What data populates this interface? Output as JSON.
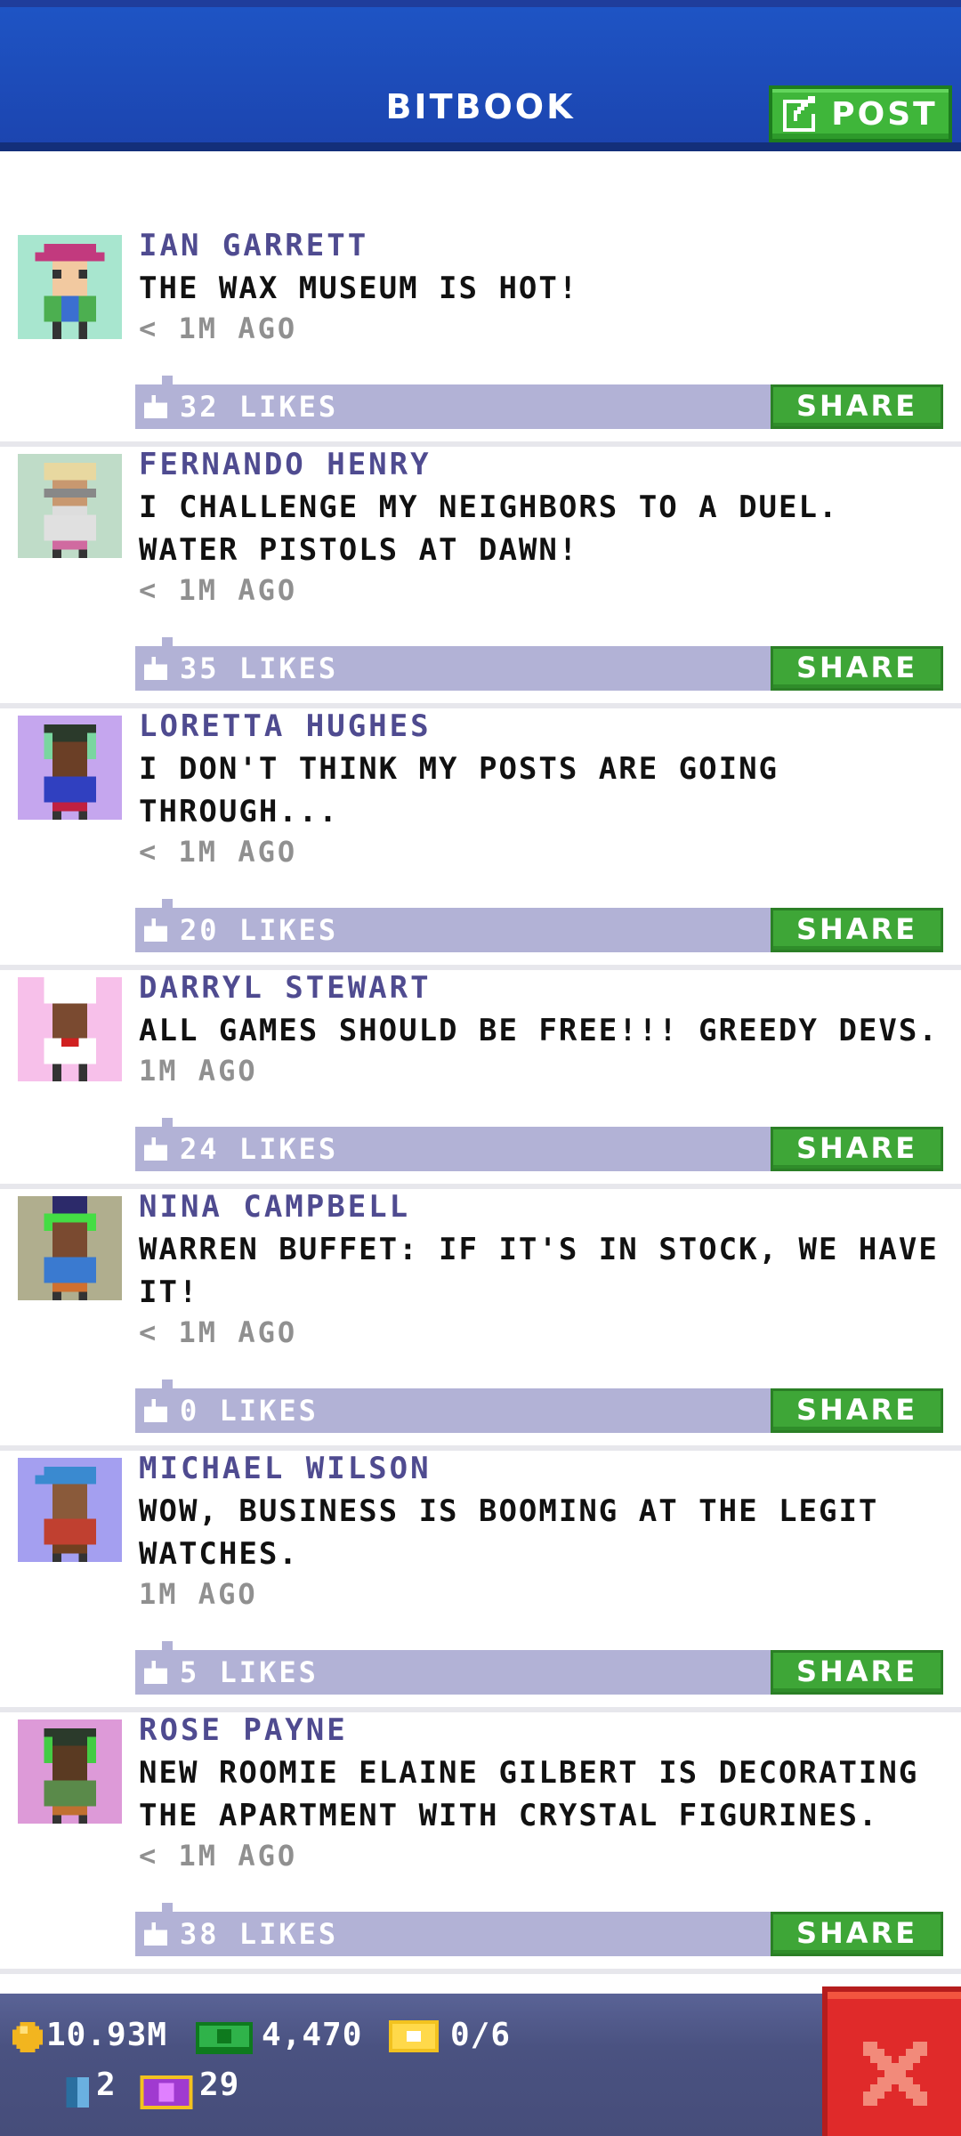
{
  "header": {
    "title": "BITBOOK",
    "post_label": "POST"
  },
  "colors": {
    "header_blue": "#1e54c4",
    "author_purple": "#4f4b90",
    "likes_bar": "#b2b2d6",
    "share_green": "#3ea637",
    "close_red": "#e02a2a"
  },
  "posts": [
    {
      "author": "IAN GARRETT",
      "message": "THE WAX MUSEUM IS HOT!",
      "time": "< 1M AGO",
      "likes": "32 LIKES",
      "share": "SHARE",
      "avatar_bg": "#a8e6cf",
      "avatar_icon": "hat-guy-avatar-icon"
    },
    {
      "author": "FERNANDO HENRY",
      "message": "I CHALLENGE MY NEIGHBORS TO A DUEL. WATER PISTOLS AT DAWN!",
      "time": "< 1M AGO",
      "likes": "35 LIKES",
      "share": "SHARE",
      "avatar_bg": "#bfdcc8",
      "avatar_icon": "old-man-avatar-icon"
    },
    {
      "author": "LORETTA HUGHES",
      "message": "I DON'T THINK MY POSTS ARE GOING THROUGH...",
      "time": "< 1M AGO",
      "likes": "20 LIKES",
      "share": "SHARE",
      "avatar_bg": "#c5a6ee",
      "avatar_icon": "headphones-woman-avatar-icon"
    },
    {
      "author": "DARRYL STEWART",
      "message": "ALL GAMES SHOULD BE FREE!!! GREEDY DEVS.",
      "time": "1M AGO",
      "likes": "24 LIKES",
      "share": "SHARE",
      "avatar_bg": "#f7c0ea",
      "avatar_icon": "chef-avatar-icon"
    },
    {
      "author": "NINA CAMPBELL",
      "message": "WARREN BUFFET: IF IT'S IN STOCK, WE HAVE IT!",
      "time": "< 1M AGO",
      "likes": "0 LIKES",
      "share": "SHARE",
      "avatar_bg": "#b0ae8e",
      "avatar_icon": "green-hair-avatar-icon"
    },
    {
      "author": "MICHAEL WILSON",
      "message": "WOW, BUSINESS IS BOOMING AT THE LEGIT WATCHES.",
      "time": "1M AGO",
      "likes": "5 LIKES",
      "share": "SHARE",
      "avatar_bg": "#a49ff0",
      "avatar_icon": "cap-guy-avatar-icon"
    },
    {
      "author": "ROSE PAYNE",
      "message": "NEW ROOMIE ELAINE GILBERT IS DECORATING THE APARTMENT WITH CRYSTAL FIGURINES.",
      "time": "< 1M AGO",
      "likes": "38 LIKES",
      "share": "SHARE",
      "avatar_bg": "#dd9ad8",
      "avatar_icon": "headset-woman-avatar-icon"
    }
  ],
  "status": {
    "coins": "10.93M",
    "cash": "4,470",
    "tickets": "0/6",
    "elevator": "2",
    "bux": "29"
  }
}
